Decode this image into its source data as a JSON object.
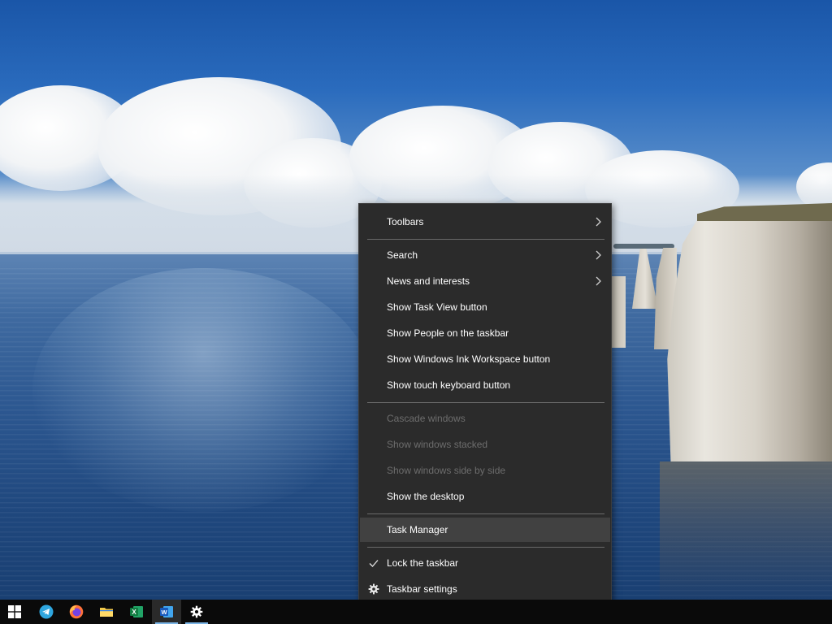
{
  "colors": {
    "menu_background": "#2b2b2b",
    "menu_text": "#ffffff",
    "menu_disabled_text": "#6d6d6d",
    "menu_highlight": "#414141",
    "separator": "#6a6a6a",
    "taskbar": "#0a0a0a",
    "running_indicator": "#7bb5e6"
  },
  "context_menu": {
    "items": [
      {
        "label": "Toolbars",
        "submenu": true
      },
      {
        "label": "Search",
        "submenu": true
      },
      {
        "label": "News and interests",
        "submenu": true
      },
      {
        "label": "Show Task View button"
      },
      {
        "label": "Show People on the taskbar"
      },
      {
        "label": "Show Windows Ink Workspace button"
      },
      {
        "label": "Show touch keyboard button"
      },
      {
        "label": "Cascade windows",
        "disabled": true
      },
      {
        "label": "Show windows stacked",
        "disabled": true
      },
      {
        "label": "Show windows side by side",
        "disabled": true
      },
      {
        "label": "Show the desktop"
      },
      {
        "label": "Task Manager",
        "highlighted": true
      },
      {
        "label": "Lock the taskbar",
        "checked": true,
        "icon": "checkmark-icon"
      },
      {
        "label": "Taskbar settings",
        "icon": "gear-icon"
      }
    ]
  },
  "taskbar": {
    "start_icon": "windows-logo-icon",
    "apps": [
      {
        "name": "Telegram",
        "icon": "telegram-icon"
      },
      {
        "name": "Firefox",
        "icon": "firefox-icon"
      },
      {
        "name": "File Explorer",
        "icon": "folder-icon"
      },
      {
        "name": "Excel",
        "icon": "excel-icon",
        "letter": "X"
      },
      {
        "name": "Word",
        "icon": "word-icon",
        "letter": "W",
        "running": true,
        "active": true
      },
      {
        "name": "Settings",
        "icon": "gear-icon",
        "running": true
      }
    ]
  }
}
